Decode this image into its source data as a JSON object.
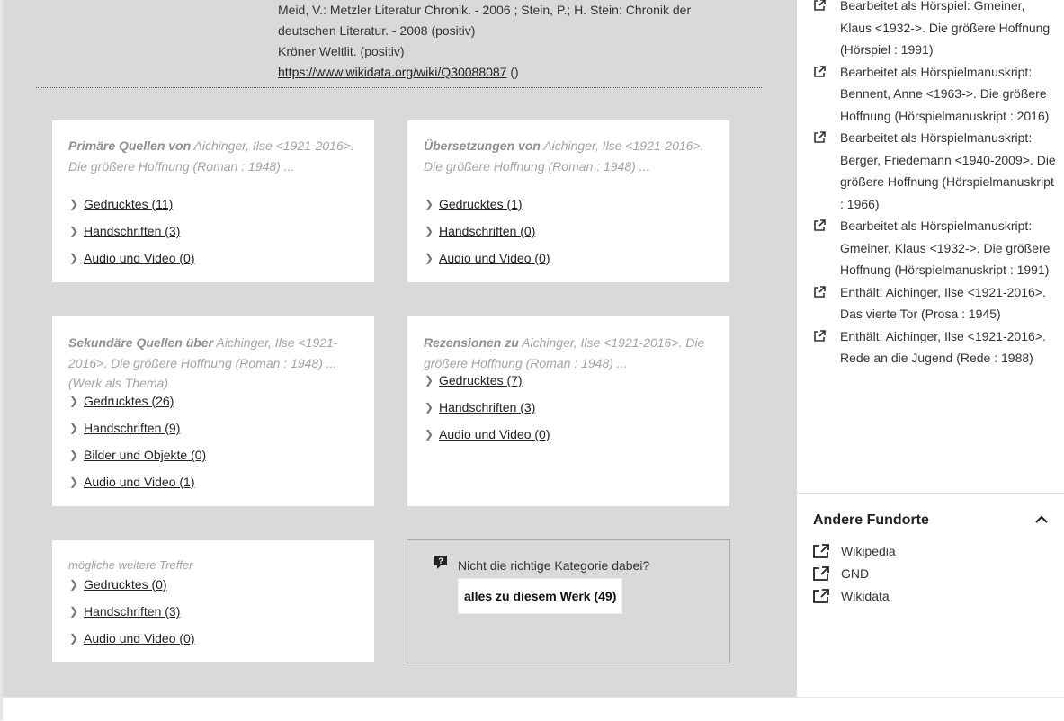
{
  "top_info": {
    "line1": "Meid, V.: Metzler Literatur Chronik. - 2006 ; Stein, P.; H. Stein: Chronik der",
    "line2": "deutschen Literatur. - 2008 (positiv)",
    "line3": "Kröner Weltlit. (positiv)",
    "link": "https://www.wikidata.org/wiki/Q30088087",
    "link_suffix": " ()"
  },
  "panels": {
    "primary": {
      "heading_bold": "Primäre Quellen von",
      "heading_rest": " Aichinger, Ilse <1921-2016>. Die größere Hoffnung (Roman : 1948) ...",
      "items": [
        "Gedrucktes (11)",
        "Handschriften (3)",
        "Audio und Video (0)"
      ]
    },
    "translations": {
      "heading_bold": "Übersetzungen von",
      "heading_rest": " Aichinger, Ilse <1921-2016>. Die größere Hoffnung (Roman : 1948) ...",
      "items": [
        "Gedrucktes (1)",
        "Handschriften (0)",
        "Audio und Video (0)"
      ]
    },
    "secondary": {
      "heading_bold": "Sekundäre Quellen über",
      "heading_rest": " Aichinger, Ilse <1921-2016>. Die größere Hoffnung (Roman : 1948) ... (Werk als Thema)",
      "items": [
        "Gedrucktes (26)",
        "Handschriften (9)",
        "Bilder und Objekte (0)",
        "Audio und Video (1)"
      ]
    },
    "reviews": {
      "heading_bold": "Rezensionen zu",
      "heading_rest": " Aichinger, Ilse <1921-2016>. Die größere Hoffnung (Roman : 1948) ...",
      "items": [
        "Gedrucktes (7)",
        "Handschriften (3)",
        "Audio und Video (0)"
      ]
    },
    "more": {
      "heading": "mögliche weitere Treffer",
      "items": [
        "Gedrucktes (0)",
        "Handschriften (3)",
        "Audio und Video (0)"
      ]
    }
  },
  "help": {
    "text": "Nicht die richtige Kategorie dabei?",
    "button": "alles zu diesem Werk (49)"
  },
  "sidebar": {
    "related": [
      "Bearbeitet als Hörspiel: Gmeiner, Klaus <1932->. Die größere Hoffnung (Hörspiel : 1991)",
      "Bearbeitet als Hörspielmanuskript: Bennent, Anne <1963->. Die größere Hoffnung (Hörspielmanuskript : 2016)",
      "Bearbeitet als Hörspielmanuskript: Berger, Friedemann <1940-2009>. Die größere Hoffnung (Hörspielmanuskript : 1966)",
      "Bearbeitet als Hörspielmanuskript: Gmeiner, Klaus <1932->. Die größere Hoffnung (Hörspielmanuskript : 1991)",
      "Enthält: Aichinger, Ilse <1921-2016>. Das vierte Tor (Prosa : 1945)",
      "Enthält: Aichinger, Ilse <1921-2016>. Rede an die Jugend (Rede : 1988)"
    ],
    "fundorte_title": "Andere Fundorte",
    "fundorte": [
      "Wikipedia",
      "GND",
      "Wikidata"
    ]
  }
}
